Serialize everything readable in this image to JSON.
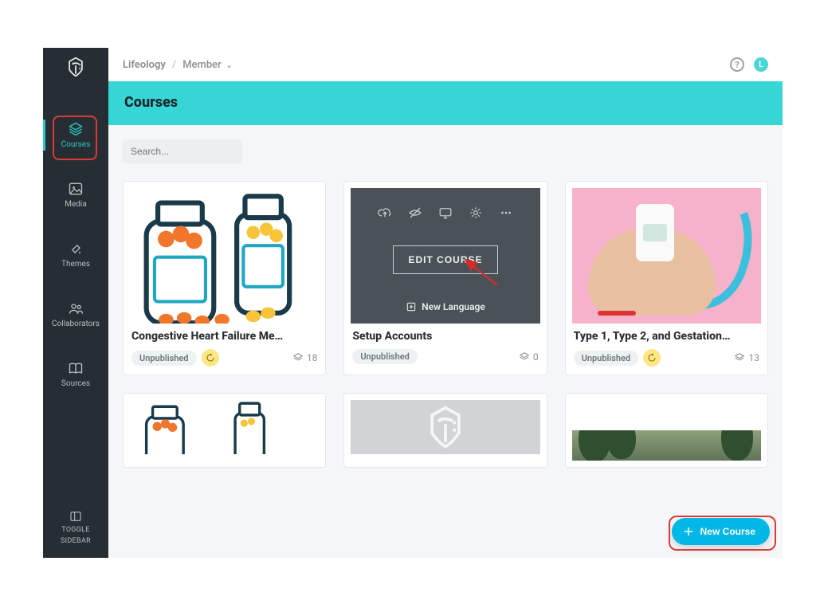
{
  "breadcrumb": {
    "root": "Lifeology",
    "section": "Member"
  },
  "avatar_initial": "L",
  "page_title": "Courses",
  "search": {
    "placeholder": "Search..."
  },
  "sidebar": {
    "items": [
      {
        "label": "Courses"
      },
      {
        "label": "Media"
      },
      {
        "label": "Themes"
      },
      {
        "label": "Collaborators"
      },
      {
        "label": "Sources"
      }
    ],
    "toggle_line1": "TOGGLE",
    "toggle_line2": "SIDEBAR"
  },
  "overlay": {
    "edit_label": "EDIT COURSE",
    "new_lang_label": "New Language"
  },
  "cards": [
    {
      "title": "Congestive Heart Failure Me…",
      "status": "Unpublished",
      "count": "18",
      "has_badge": true
    },
    {
      "title": "Setup Accounts",
      "status": "Unpublished",
      "count": "0",
      "has_badge": false
    },
    {
      "title": "Type 1, Type 2, and Gestation…",
      "status": "Unpublished",
      "count": "13",
      "has_badge": true
    }
  ],
  "new_course_label": "New Course"
}
